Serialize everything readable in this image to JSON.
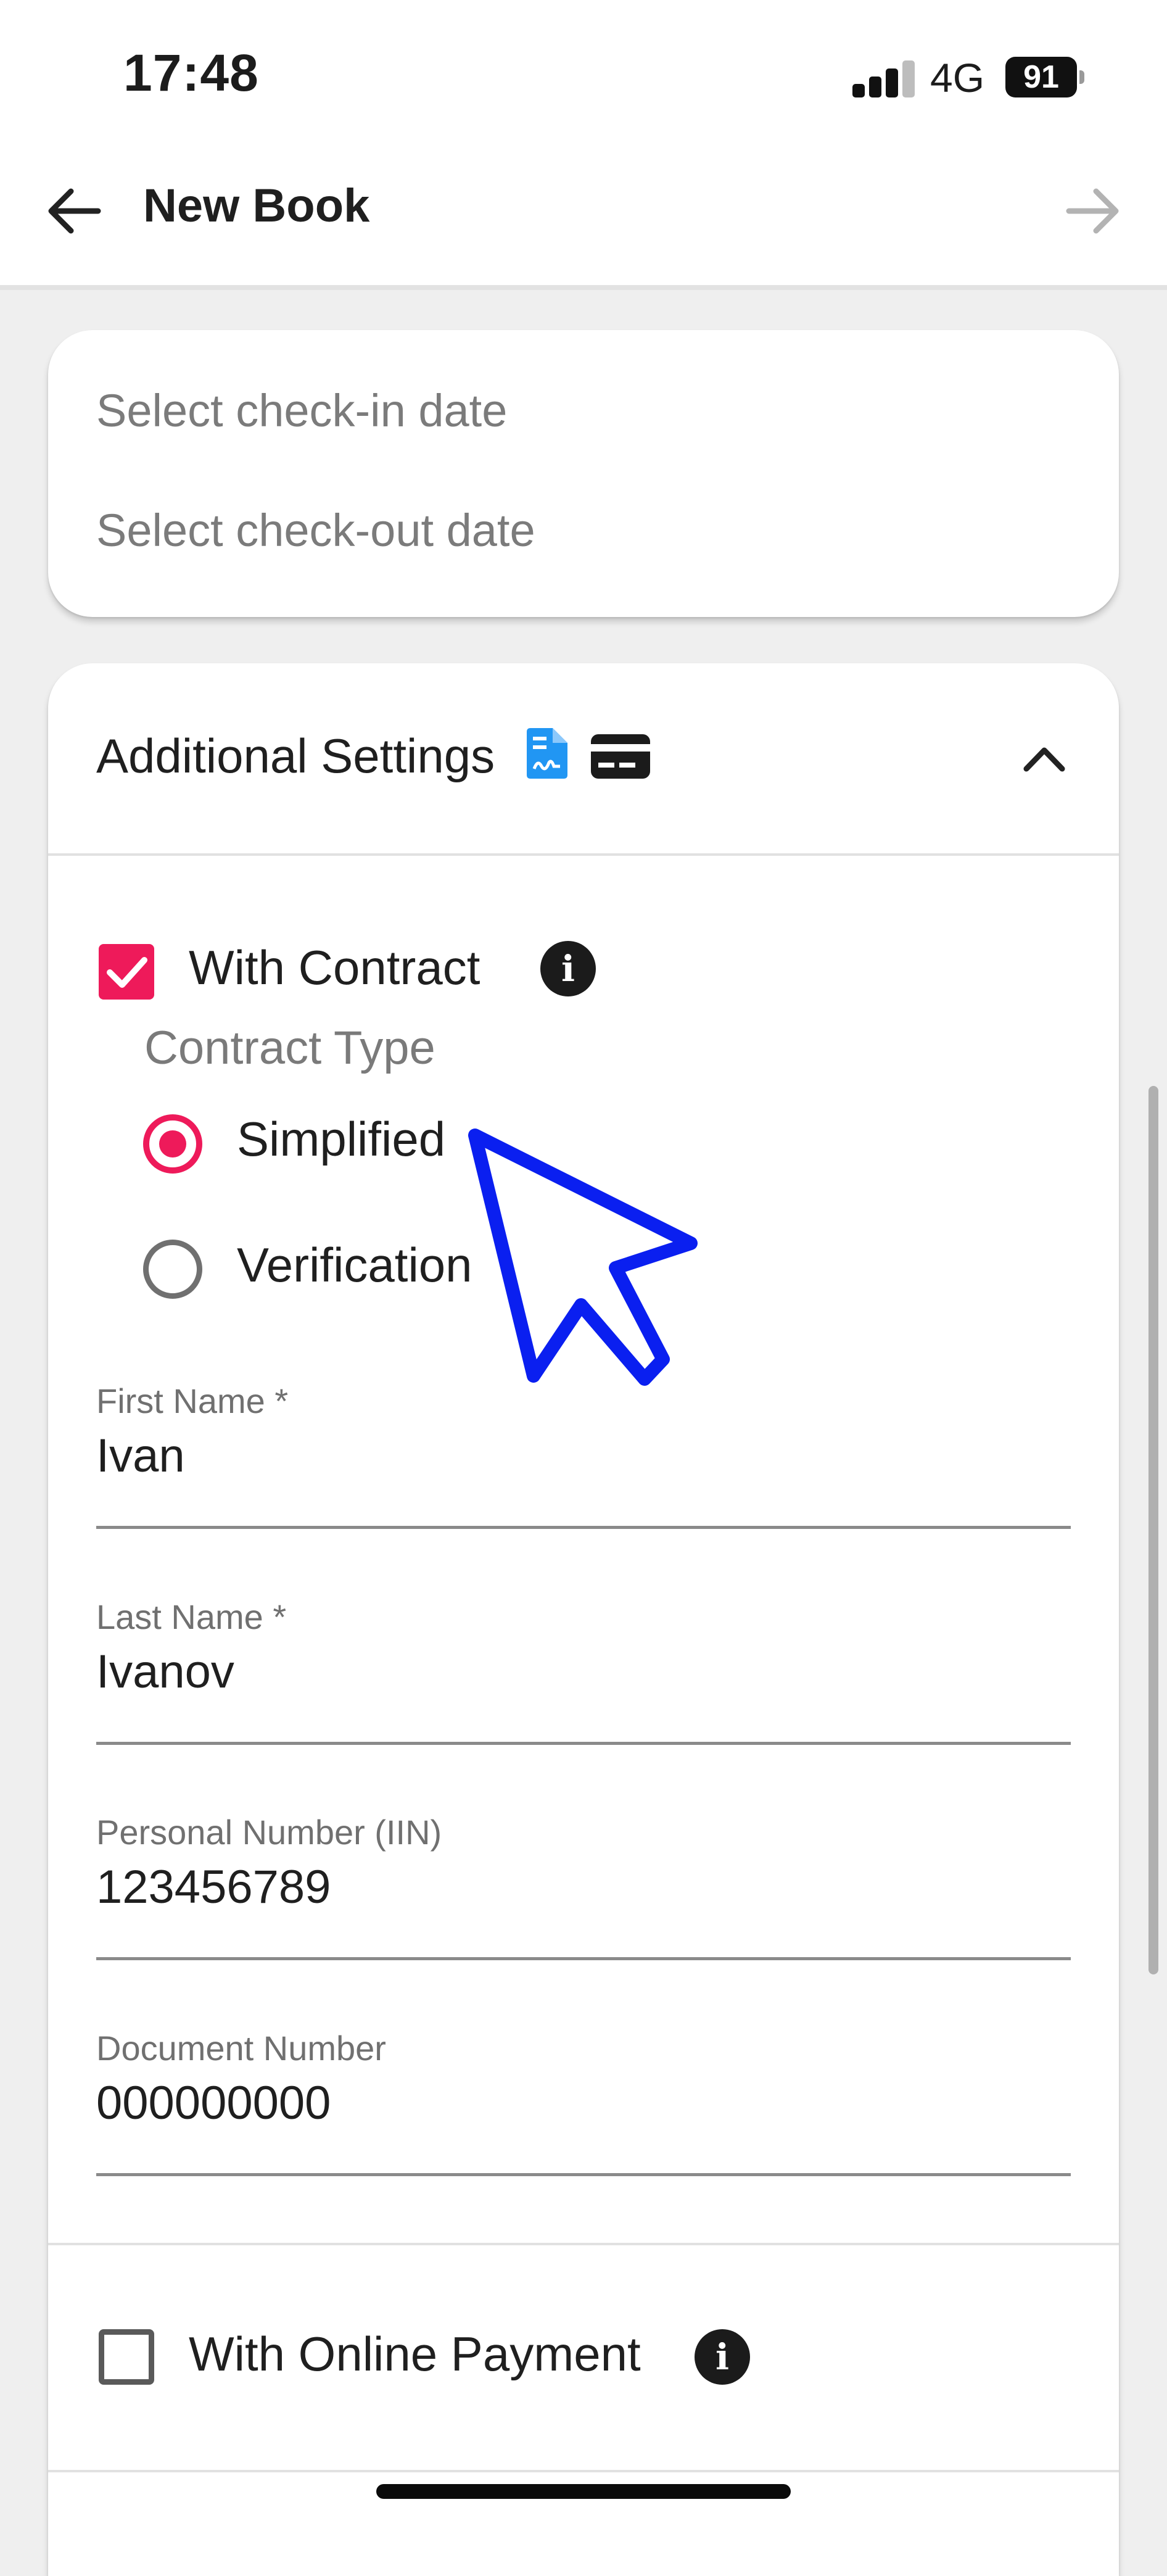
{
  "status_bar": {
    "time": "17:48",
    "network": "4G",
    "battery": "91"
  },
  "app_bar": {
    "title": "New Book"
  },
  "dates": {
    "checkin_placeholder": "Select check-in date",
    "checkout_placeholder": "Select check-out date"
  },
  "settings": {
    "title": "Additional Settings",
    "icons": [
      "document-icon",
      "credit-card-icon"
    ],
    "with_contract": {
      "label": "With Contract",
      "checked": true
    },
    "contract_type": {
      "heading": "Contract Type",
      "options": [
        {
          "label": "Simplified",
          "selected": true
        },
        {
          "label": "Verification",
          "selected": false
        }
      ]
    },
    "fields": [
      {
        "label": "First Name *",
        "value": "Ivan"
      },
      {
        "label": "Last Name *",
        "value": "Ivanov"
      },
      {
        "label": "Personal Number (IIN)",
        "value": "123456789"
      },
      {
        "label": "Document Number",
        "value": "000000000"
      }
    ],
    "with_online_payment": {
      "label": "With Online Payment",
      "checked": false
    }
  },
  "colors": {
    "accent": "#ee1a5a",
    "doc_icon": "#2196f3",
    "cursor": "#0a1ff0"
  }
}
